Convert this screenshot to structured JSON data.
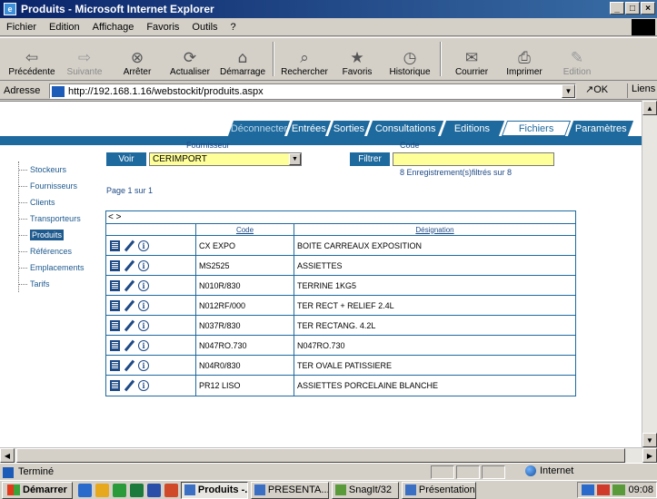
{
  "window": {
    "title": "Produits - Microsoft Internet Explorer",
    "min": "_",
    "max": "̲͡",
    "close": "×"
  },
  "menu": [
    "Fichier",
    "Edition",
    "Affichage",
    "Favoris",
    "Outils",
    "?"
  ],
  "toolbar": [
    {
      "label": "Précédente",
      "icon": "⇦",
      "enabled": true
    },
    {
      "label": "Suivante",
      "icon": "⇨",
      "enabled": false
    },
    {
      "label": "Arrêter",
      "icon": "⊗",
      "enabled": true
    },
    {
      "label": "Actualiser",
      "icon": "⟳",
      "enabled": true
    },
    {
      "label": "Démarrage",
      "icon": "⌂",
      "enabled": true
    },
    {
      "label": "Rechercher",
      "icon": "⌕",
      "enabled": true
    },
    {
      "label": "Favoris",
      "icon": "★",
      "enabled": true
    },
    {
      "label": "Historique",
      "icon": "◷",
      "enabled": true
    },
    {
      "label": "Courrier",
      "icon": "✉",
      "enabled": true
    },
    {
      "label": "Imprimer",
      "icon": "⎙",
      "enabled": true
    },
    {
      "label": "Edition",
      "icon": "✎",
      "enabled": false
    }
  ],
  "address": {
    "label": "Adresse",
    "url": "http://192.168.1.16/webstockit/produits.aspx",
    "go": "OK",
    "links": "Liens"
  },
  "tabs": [
    {
      "label": "Déconnecter",
      "style": "current"
    },
    {
      "label": "Entrées",
      "style": "dark"
    },
    {
      "label": "Sorties",
      "style": "dark"
    },
    {
      "label": "Consultations",
      "style": "dark"
    },
    {
      "label": "Editions",
      "style": "dark"
    },
    {
      "label": "Fichiers",
      "style": "light"
    },
    {
      "label": "Paramètres",
      "style": "dark"
    }
  ],
  "sidebar": [
    "Stockeurs",
    "Fournisseurs",
    "Clients",
    "Transporteurs",
    "Produits",
    "Références",
    "Emplacements",
    "Tarifs"
  ],
  "sidebar_selected": "Produits",
  "filters": {
    "fournisseur_label": "Fournisseur",
    "fournisseur_value": "CERIMPORT",
    "code_label": "Code",
    "code_value": "",
    "voir_button": "Voir",
    "filtrer_button": "Filtrer",
    "records": "8 Enregistrement(s)filtrés sur 8"
  },
  "grid": {
    "page_info": "Page 1 sur 1",
    "nav": "< >",
    "headers": {
      "code": "Code",
      "designation": "Désignation"
    },
    "rows": [
      {
        "code": "CX EXPO",
        "designation": "BOITE CARREAUX EXPOSITION"
      },
      {
        "code": "MS2525",
        "designation": "ASSIETTES"
      },
      {
        "code": "N010R/830",
        "designation": "TERRINE 1KG5"
      },
      {
        "code": "N012RF/000",
        "designation": "TER RECT + RELIEF 2.4L"
      },
      {
        "code": "N037R/830",
        "designation": "TER RECTANG. 4.2L"
      },
      {
        "code": "N047RO.730",
        "designation": "N047RO.730"
      },
      {
        "code": "N04R0/830",
        "designation": "TER OVALE PATISSIERE"
      },
      {
        "code": "PR12 LISO",
        "designation": "ASSIETTES PORCELAINE BLANCHE"
      }
    ]
  },
  "status": {
    "text": "Terminé",
    "zone": "Internet"
  },
  "taskbar": {
    "start": "Démarrer",
    "tasks": [
      {
        "label": "Produits -...",
        "active": true
      },
      {
        "label": "PRESENTA...",
        "active": false
      },
      {
        "label": "SnagIt/32",
        "active": false
      },
      {
        "label": "Présentation...",
        "active": false
      }
    ],
    "clock": "09:08"
  }
}
